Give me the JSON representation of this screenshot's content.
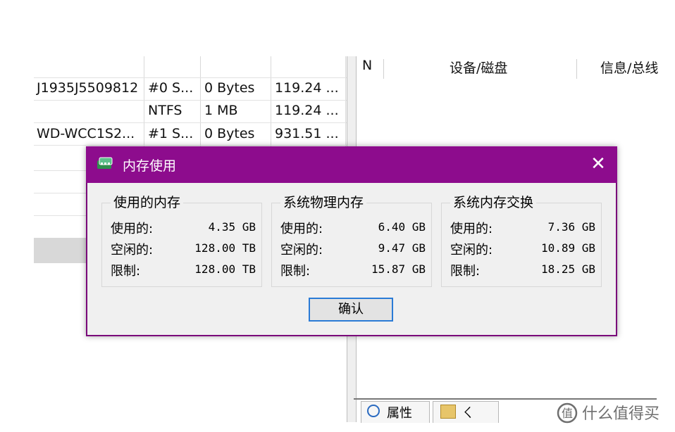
{
  "left_table": {
    "rows": [
      [
        "J1935J5509812",
        "#0 S...",
        "0 Bytes",
        "119.24 ..."
      ],
      [
        "",
        "NTFS",
        "1 MB",
        "119.24 ..."
      ],
      [
        "WD-WCC1S2...",
        "#1 S...",
        "0 Bytes",
        "931.51 ..."
      ]
    ]
  },
  "right_pane": {
    "headers": [
      "N",
      "设备/磁盘",
      "信息/总线"
    ],
    "tabs": [
      "属性",
      "ㄑ"
    ]
  },
  "dialog": {
    "title": "内存使用",
    "close": "✕",
    "groups": [
      {
        "title": "使用的内存",
        "rows": [
          {
            "label": "使用的:",
            "value": "4.35 GB"
          },
          {
            "label": "空闲的:",
            "value": "128.00 TB"
          },
          {
            "label": "限制:",
            "value": "128.00 TB"
          }
        ]
      },
      {
        "title": "系统物理内存",
        "rows": [
          {
            "label": "使用的:",
            "value": "6.40 GB"
          },
          {
            "label": "空闲的:",
            "value": "9.47 GB"
          },
          {
            "label": "限制:",
            "value": "15.87 GB"
          }
        ]
      },
      {
        "title": "系统内存交换",
        "rows": [
          {
            "label": "使用的:",
            "value": "7.36 GB"
          },
          {
            "label": "空闲的:",
            "value": "10.89 GB"
          },
          {
            "label": "限制:",
            "value": "18.25 GB"
          }
        ]
      }
    ],
    "ok_label": "确认"
  },
  "watermark": {
    "text": "什么值得买"
  },
  "colors": {
    "titlebar": "#8d0c8d",
    "ok_border": "#2a7bd6",
    "client_bg": "#f0f0f0"
  },
  "icons": {
    "app": "memory-chip-icon",
    "close": "close-icon",
    "watermark": "zhide-logo-icon"
  }
}
